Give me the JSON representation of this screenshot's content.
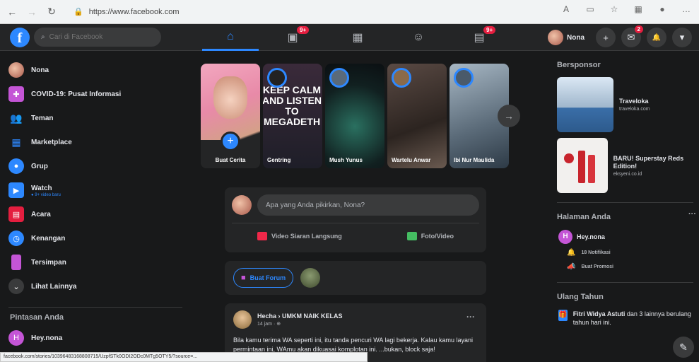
{
  "browser": {
    "url": "https://www.facebook.com",
    "back": "←",
    "forward": "→",
    "reload": "↻"
  },
  "nav": {
    "logo": "f",
    "search_placeholder": "Cari di Facebook",
    "tabs": [
      {
        "name": "home-icon",
        "glyph": "⌂"
      },
      {
        "name": "watch-icon",
        "glyph": "▣",
        "badge": "9+"
      },
      {
        "name": "marketplace-icon",
        "glyph": "▦"
      },
      {
        "name": "groups-icon",
        "glyph": "☺"
      },
      {
        "name": "gaming-icon",
        "glyph": "▤",
        "badge": "9+"
      }
    ],
    "profile_name": "Nona",
    "plus": "+",
    "messenger_badge": "2",
    "messenger": "✉",
    "notifications": "🔔",
    "menu": "▾"
  },
  "left_sidebar": {
    "items": [
      {
        "label": "Nona",
        "icon": "avatar",
        "color": "#b4584a"
      },
      {
        "label": "COVID-19: Pusat Informasi",
        "icon": "covid-icon",
        "color": "#c455d6"
      },
      {
        "label": "Teman",
        "icon": "friends-icon",
        "color": "#2d88ff"
      },
      {
        "label": "Marketplace",
        "icon": "marketplace-icon",
        "color": "#2d88ff"
      },
      {
        "label": "Grup",
        "icon": "groups-icon",
        "color": "#2d88ff"
      },
      {
        "label": "Watch",
        "icon": "watch-icon",
        "color": "#2d88ff",
        "sub": "● 9+ video baru"
      },
      {
        "label": "Acara",
        "icon": "events-icon",
        "color": "#e41e3f"
      },
      {
        "label": "Kenangan",
        "icon": "memories-icon",
        "color": "#2d88ff"
      },
      {
        "label": "Tersimpan",
        "icon": "saved-icon",
        "color": "#c455d6"
      },
      {
        "label": "Lihat Lainnya",
        "icon": "chevron-down-icon",
        "color": "#3a3b3c"
      }
    ],
    "shortcuts_heading": "Pintasan Anda",
    "shortcut": {
      "label": "Hey.nona",
      "initial": "H"
    }
  },
  "stories": {
    "create_label": "Buat Cerita",
    "items": [
      {
        "name": "Gentring",
        "overlay": "KEEP CALM AND LISTEN TO MEGADETH"
      },
      {
        "name": "Mush Yunus"
      },
      {
        "name": "Wartelu Anwar"
      },
      {
        "name": "Ibi Nur Maulida"
      }
    ],
    "arrow": "→"
  },
  "composer": {
    "placeholder": "Apa yang Anda pikirkan, Nona?",
    "live_label": "Video Siaran Langsung",
    "photo_label": "Foto/Video"
  },
  "room": {
    "button_label": "Buat Forum"
  },
  "post": {
    "author": "Hecha › UMKM NAIK KELAS",
    "meta": "14 jam · ⊕",
    "more": "···",
    "text": "Bila kamu terima WA seperti ini, itu tanda pencuri WA lagi bekerja. Kalau kamu layani permintaan ini, WAmu akan dikuasai komplotan ini. ...bukan, block saja!"
  },
  "right_sidebar": {
    "sponsored_heading": "Bersponsor",
    "ads": [
      {
        "title": "Traveloka",
        "domain": "traveloka.com"
      },
      {
        "title": "BARU! Superstay Reds Edition!",
        "domain": "eksyeni.co.id"
      }
    ],
    "pages_heading": "Halaman Anda",
    "page_name": "Hey.nona",
    "page_initial": "H",
    "notif_label": "18 Notifikasi",
    "promo_label": "Buat Promosi",
    "bday_heading": "Ulang Tahun",
    "bday_text_bold": "Fitri Widya Astuti",
    "bday_text_rest": " dan 3 lainnya berulang tahun hari ini.",
    "more_dots": "···"
  },
  "status_url": "facebook.com/stories/10396483168808715/UzpfSTk0ODI2ODc0MTg5OTY5/?source=..."
}
